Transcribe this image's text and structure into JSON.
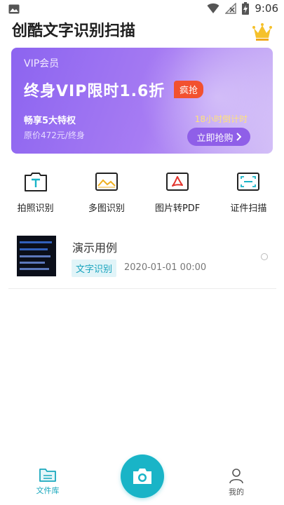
{
  "status_bar": {
    "time": "9:06",
    "icons": [
      "image-icon",
      "wifi-icon",
      "no-signal-icon",
      "battery-charging-icon"
    ]
  },
  "header": {
    "title": "创酷文字识别扫描",
    "crown_icon": "crown-icon",
    "crown_color": "#f5c12b"
  },
  "vip_card": {
    "label": "VIP会员",
    "headline": "终身VIP限时1.6折",
    "badge": "疯抢",
    "privilege": "畅享5大特权",
    "original_price": "原价472元/终身",
    "countdown": "18小时倒计时",
    "cta": "立即抢购",
    "cta_icon": "chevron-right-icon",
    "colors": {
      "start": "#8c64f0",
      "end": "#d3bff7",
      "badge": "#f2512f",
      "countdown": "#ffe27a"
    }
  },
  "features": [
    {
      "label": "拍照识别",
      "icon": "text-camera-icon"
    },
    {
      "label": "多图识别",
      "icon": "multi-image-icon"
    },
    {
      "label": "图片转PDF",
      "icon": "pdf-icon"
    },
    {
      "label": "证件扫描",
      "icon": "id-scan-icon"
    }
  ],
  "documents": [
    {
      "title": "演示用例",
      "tag": "文字识别",
      "date": "2020-01-01 00:00"
    }
  ],
  "tabbar": {
    "files_label": "文件库",
    "mine_label": "我的",
    "camera_icon": "camera-icon",
    "accent": "#19b4c7"
  }
}
